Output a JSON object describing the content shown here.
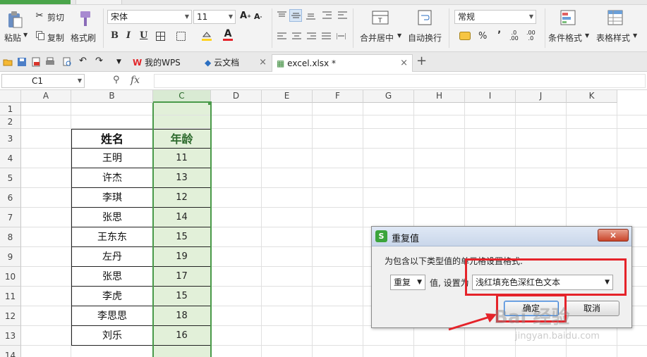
{
  "ribbon": {
    "paste_label": "粘贴",
    "cut_label": "剪切",
    "copy_label": "复制",
    "format_painter_label": "格式刷",
    "font_name": "宋体",
    "font_size": "11",
    "bold": "B",
    "italic": "I",
    "underline": "U",
    "merge_center_label": "合并居中",
    "wrap_text_label": "自动换行",
    "number_format": "常规",
    "percent": "%",
    "comma": "’",
    "conditional_format_label": "条件格式",
    "table_style_label": "表格样式"
  },
  "tabs": {
    "my_wps": "我的WPS",
    "cloud_docs": "云文档",
    "file_tab": "excel.xlsx *",
    "close": "×",
    "add": "+"
  },
  "formula_bar": {
    "name_box": "C1",
    "fx": "fx"
  },
  "grid": {
    "columns": [
      "A",
      "B",
      "C",
      "D",
      "E",
      "F",
      "G",
      "H",
      "I",
      "J",
      "K"
    ],
    "rows": [
      "1",
      "2",
      "3",
      "4",
      "5",
      "6",
      "7",
      "8",
      "9",
      "10",
      "11",
      "12",
      "13",
      "14"
    ],
    "header_name": "姓名",
    "header_age": "年龄",
    "records": [
      {
        "name": "王明",
        "age": "11"
      },
      {
        "name": "许杰",
        "age": "13"
      },
      {
        "name": "李琪",
        "age": "12"
      },
      {
        "name": "张思",
        "age": "14"
      },
      {
        "name": "王东东",
        "age": "15"
      },
      {
        "name": "左丹",
        "age": "19"
      },
      {
        "name": "张思",
        "age": "17"
      },
      {
        "name": "李虎",
        "age": "15"
      },
      {
        "name": "李思思",
        "age": "18"
      },
      {
        "name": "刘乐",
        "age": "16"
      }
    ]
  },
  "dialog": {
    "logo": "S",
    "title": "重复值",
    "close": "×",
    "description": "为包含以下类型值的单元格设置格式:",
    "rule_type": "重复",
    "middle_text": "值, 设置为",
    "format_choice": "浅红填充色深红色文本",
    "ok_label": "确定",
    "cancel_label": "取消"
  },
  "watermark": {
    "text": "Bai 经验",
    "sub": "jingyan.baidu.com"
  },
  "colors": {
    "selection_green": "#4a9a4a",
    "selected_fill": "#e2f0d9",
    "annotation_red": "#e5232a"
  }
}
